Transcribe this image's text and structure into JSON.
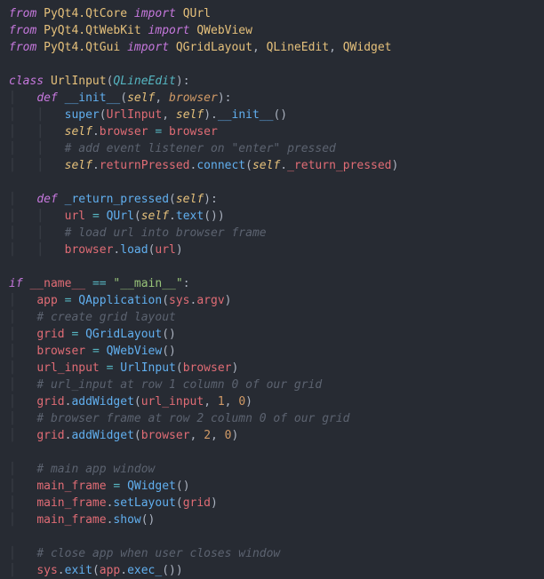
{
  "language": "python",
  "theme": "one-dark",
  "tokens": [
    [
      [
        "kw",
        "from"
      ],
      [
        "sp",
        " "
      ],
      [
        "mod",
        "PyQt4.QtCore"
      ],
      [
        "sp",
        " "
      ],
      [
        "kw",
        "import"
      ],
      [
        "sp",
        " "
      ],
      [
        "type",
        "QUrl"
      ]
    ],
    [
      [
        "kw",
        "from"
      ],
      [
        "sp",
        " "
      ],
      [
        "mod",
        "PyQt4.QtWebKit"
      ],
      [
        "sp",
        " "
      ],
      [
        "kw",
        "import"
      ],
      [
        "sp",
        " "
      ],
      [
        "type",
        "QWebView"
      ]
    ],
    [
      [
        "kw",
        "from"
      ],
      [
        "sp",
        " "
      ],
      [
        "mod",
        "PyQt4.QtGui"
      ],
      [
        "sp",
        " "
      ],
      [
        "kw",
        "import"
      ],
      [
        "sp",
        " "
      ],
      [
        "type",
        "QGridLayout"
      ],
      [
        "punc",
        ", "
      ],
      [
        "type",
        "QLineEdit"
      ],
      [
        "punc",
        ", "
      ],
      [
        "type",
        "QWidget"
      ]
    ],
    [],
    [
      [
        "kw",
        "class"
      ],
      [
        "sp",
        " "
      ],
      [
        "type",
        "UrlInput"
      ],
      [
        "punc",
        "("
      ],
      [
        "fni",
        "QLineEdit"
      ],
      [
        "punc",
        "):"
      ]
    ],
    [
      [
        "guide",
        "    "
      ],
      [
        "kw",
        "def"
      ],
      [
        "sp",
        " "
      ],
      [
        "fn",
        "__init__"
      ],
      [
        "punc",
        "("
      ],
      [
        "self",
        "self"
      ],
      [
        "punc",
        ", "
      ],
      [
        "param",
        "browser"
      ],
      [
        "punc",
        "):"
      ]
    ],
    [
      [
        "guide",
        "        "
      ],
      [
        "fn",
        "super"
      ],
      [
        "punc",
        "("
      ],
      [
        "id",
        "UrlInput"
      ],
      [
        "punc",
        ", "
      ],
      [
        "self",
        "self"
      ],
      [
        "punc",
        ")."
      ],
      [
        "fn",
        "__init__"
      ],
      [
        "punc",
        "()"
      ]
    ],
    [
      [
        "guide",
        "        "
      ],
      [
        "self",
        "self"
      ],
      [
        "punc",
        "."
      ],
      [
        "id",
        "browser"
      ],
      [
        "sp",
        " "
      ],
      [
        "op",
        "="
      ],
      [
        "sp",
        " "
      ],
      [
        "id",
        "browser"
      ]
    ],
    [
      [
        "guide",
        "        "
      ],
      [
        "cmt",
        "# add event listener on \"enter\" pressed"
      ]
    ],
    [
      [
        "guide",
        "        "
      ],
      [
        "self",
        "self"
      ],
      [
        "punc",
        "."
      ],
      [
        "id",
        "returnPressed"
      ],
      [
        "punc",
        "."
      ],
      [
        "fn",
        "connect"
      ],
      [
        "punc",
        "("
      ],
      [
        "self",
        "self"
      ],
      [
        "punc",
        "."
      ],
      [
        "id",
        "_return_pressed"
      ],
      [
        "punc",
        ")"
      ]
    ],
    [],
    [
      [
        "guide",
        "    "
      ],
      [
        "kw",
        "def"
      ],
      [
        "sp",
        " "
      ],
      [
        "fn",
        "_return_pressed"
      ],
      [
        "punc",
        "("
      ],
      [
        "self",
        "self"
      ],
      [
        "punc",
        "):"
      ]
    ],
    [
      [
        "guide",
        "        "
      ],
      [
        "id",
        "url"
      ],
      [
        "sp",
        " "
      ],
      [
        "op",
        "="
      ],
      [
        "sp",
        " "
      ],
      [
        "fn",
        "QUrl"
      ],
      [
        "punc",
        "("
      ],
      [
        "self",
        "self"
      ],
      [
        "punc",
        "."
      ],
      [
        "fn",
        "text"
      ],
      [
        "punc",
        "())"
      ]
    ],
    [
      [
        "guide",
        "        "
      ],
      [
        "cmt",
        "# load url into browser frame"
      ]
    ],
    [
      [
        "guide",
        "        "
      ],
      [
        "id",
        "browser"
      ],
      [
        "punc",
        "."
      ],
      [
        "fn",
        "load"
      ],
      [
        "punc",
        "("
      ],
      [
        "id",
        "url"
      ],
      [
        "punc",
        ")"
      ]
    ],
    [],
    [
      [
        "kw",
        "if"
      ],
      [
        "sp",
        " "
      ],
      [
        "id",
        "__name__"
      ],
      [
        "sp",
        " "
      ],
      [
        "op",
        "=="
      ],
      [
        "sp",
        " "
      ],
      [
        "str",
        "\"__main__\""
      ],
      [
        "punc",
        ":"
      ]
    ],
    [
      [
        "guide",
        "    "
      ],
      [
        "id",
        "app"
      ],
      [
        "sp",
        " "
      ],
      [
        "op",
        "="
      ],
      [
        "sp",
        " "
      ],
      [
        "fn",
        "QApplication"
      ],
      [
        "punc",
        "("
      ],
      [
        "id",
        "sys"
      ],
      [
        "punc",
        "."
      ],
      [
        "id",
        "argv"
      ],
      [
        "punc",
        ")"
      ]
    ],
    [
      [
        "guide",
        "    "
      ],
      [
        "cmt",
        "# create grid layout"
      ]
    ],
    [
      [
        "guide",
        "    "
      ],
      [
        "id",
        "grid"
      ],
      [
        "sp",
        " "
      ],
      [
        "op",
        "="
      ],
      [
        "sp",
        " "
      ],
      [
        "fn",
        "QGridLayout"
      ],
      [
        "punc",
        "()"
      ]
    ],
    [
      [
        "guide",
        "    "
      ],
      [
        "id",
        "browser"
      ],
      [
        "sp",
        " "
      ],
      [
        "op",
        "="
      ],
      [
        "sp",
        " "
      ],
      [
        "fn",
        "QWebView"
      ],
      [
        "punc",
        "()"
      ]
    ],
    [
      [
        "guide",
        "    "
      ],
      [
        "id",
        "url_input"
      ],
      [
        "sp",
        " "
      ],
      [
        "op",
        "="
      ],
      [
        "sp",
        " "
      ],
      [
        "fn",
        "UrlInput"
      ],
      [
        "punc",
        "("
      ],
      [
        "id",
        "browser"
      ],
      [
        "punc",
        ")"
      ]
    ],
    [
      [
        "guide",
        "    "
      ],
      [
        "cmt",
        "# url_input at row 1 column 0 of our grid"
      ]
    ],
    [
      [
        "guide",
        "    "
      ],
      [
        "id",
        "grid"
      ],
      [
        "punc",
        "."
      ],
      [
        "fn",
        "addWidget"
      ],
      [
        "punc",
        "("
      ],
      [
        "id",
        "url_input"
      ],
      [
        "punc",
        ", "
      ],
      [
        "num",
        "1"
      ],
      [
        "punc",
        ", "
      ],
      [
        "num",
        "0"
      ],
      [
        "punc",
        ")"
      ]
    ],
    [
      [
        "guide",
        "    "
      ],
      [
        "cmt",
        "# browser frame at row 2 column 0 of our grid"
      ]
    ],
    [
      [
        "guide",
        "    "
      ],
      [
        "id",
        "grid"
      ],
      [
        "punc",
        "."
      ],
      [
        "fn",
        "addWidget"
      ],
      [
        "punc",
        "("
      ],
      [
        "id",
        "browser"
      ],
      [
        "punc",
        ", "
      ],
      [
        "num",
        "2"
      ],
      [
        "punc",
        ", "
      ],
      [
        "num",
        "0"
      ],
      [
        "punc",
        ")"
      ]
    ],
    [],
    [
      [
        "guide",
        "    "
      ],
      [
        "cmt",
        "# main app window"
      ]
    ],
    [
      [
        "guide",
        "    "
      ],
      [
        "id",
        "main_frame"
      ],
      [
        "sp",
        " "
      ],
      [
        "op",
        "="
      ],
      [
        "sp",
        " "
      ],
      [
        "fn",
        "QWidget"
      ],
      [
        "punc",
        "()"
      ]
    ],
    [
      [
        "guide",
        "    "
      ],
      [
        "id",
        "main_frame"
      ],
      [
        "punc",
        "."
      ],
      [
        "fn",
        "setLayout"
      ],
      [
        "punc",
        "("
      ],
      [
        "id",
        "grid"
      ],
      [
        "punc",
        ")"
      ]
    ],
    [
      [
        "guide",
        "    "
      ],
      [
        "id",
        "main_frame"
      ],
      [
        "punc",
        "."
      ],
      [
        "fn",
        "show"
      ],
      [
        "punc",
        "()"
      ]
    ],
    [],
    [
      [
        "guide",
        "    "
      ],
      [
        "cmt",
        "# close app when user closes window"
      ]
    ],
    [
      [
        "guide",
        "    "
      ],
      [
        "id",
        "sys"
      ],
      [
        "punc",
        "."
      ],
      [
        "fn",
        "exit"
      ],
      [
        "punc",
        "("
      ],
      [
        "id",
        "app"
      ],
      [
        "punc",
        "."
      ],
      [
        "fn",
        "exec_"
      ],
      [
        "punc",
        "())"
      ]
    ]
  ]
}
